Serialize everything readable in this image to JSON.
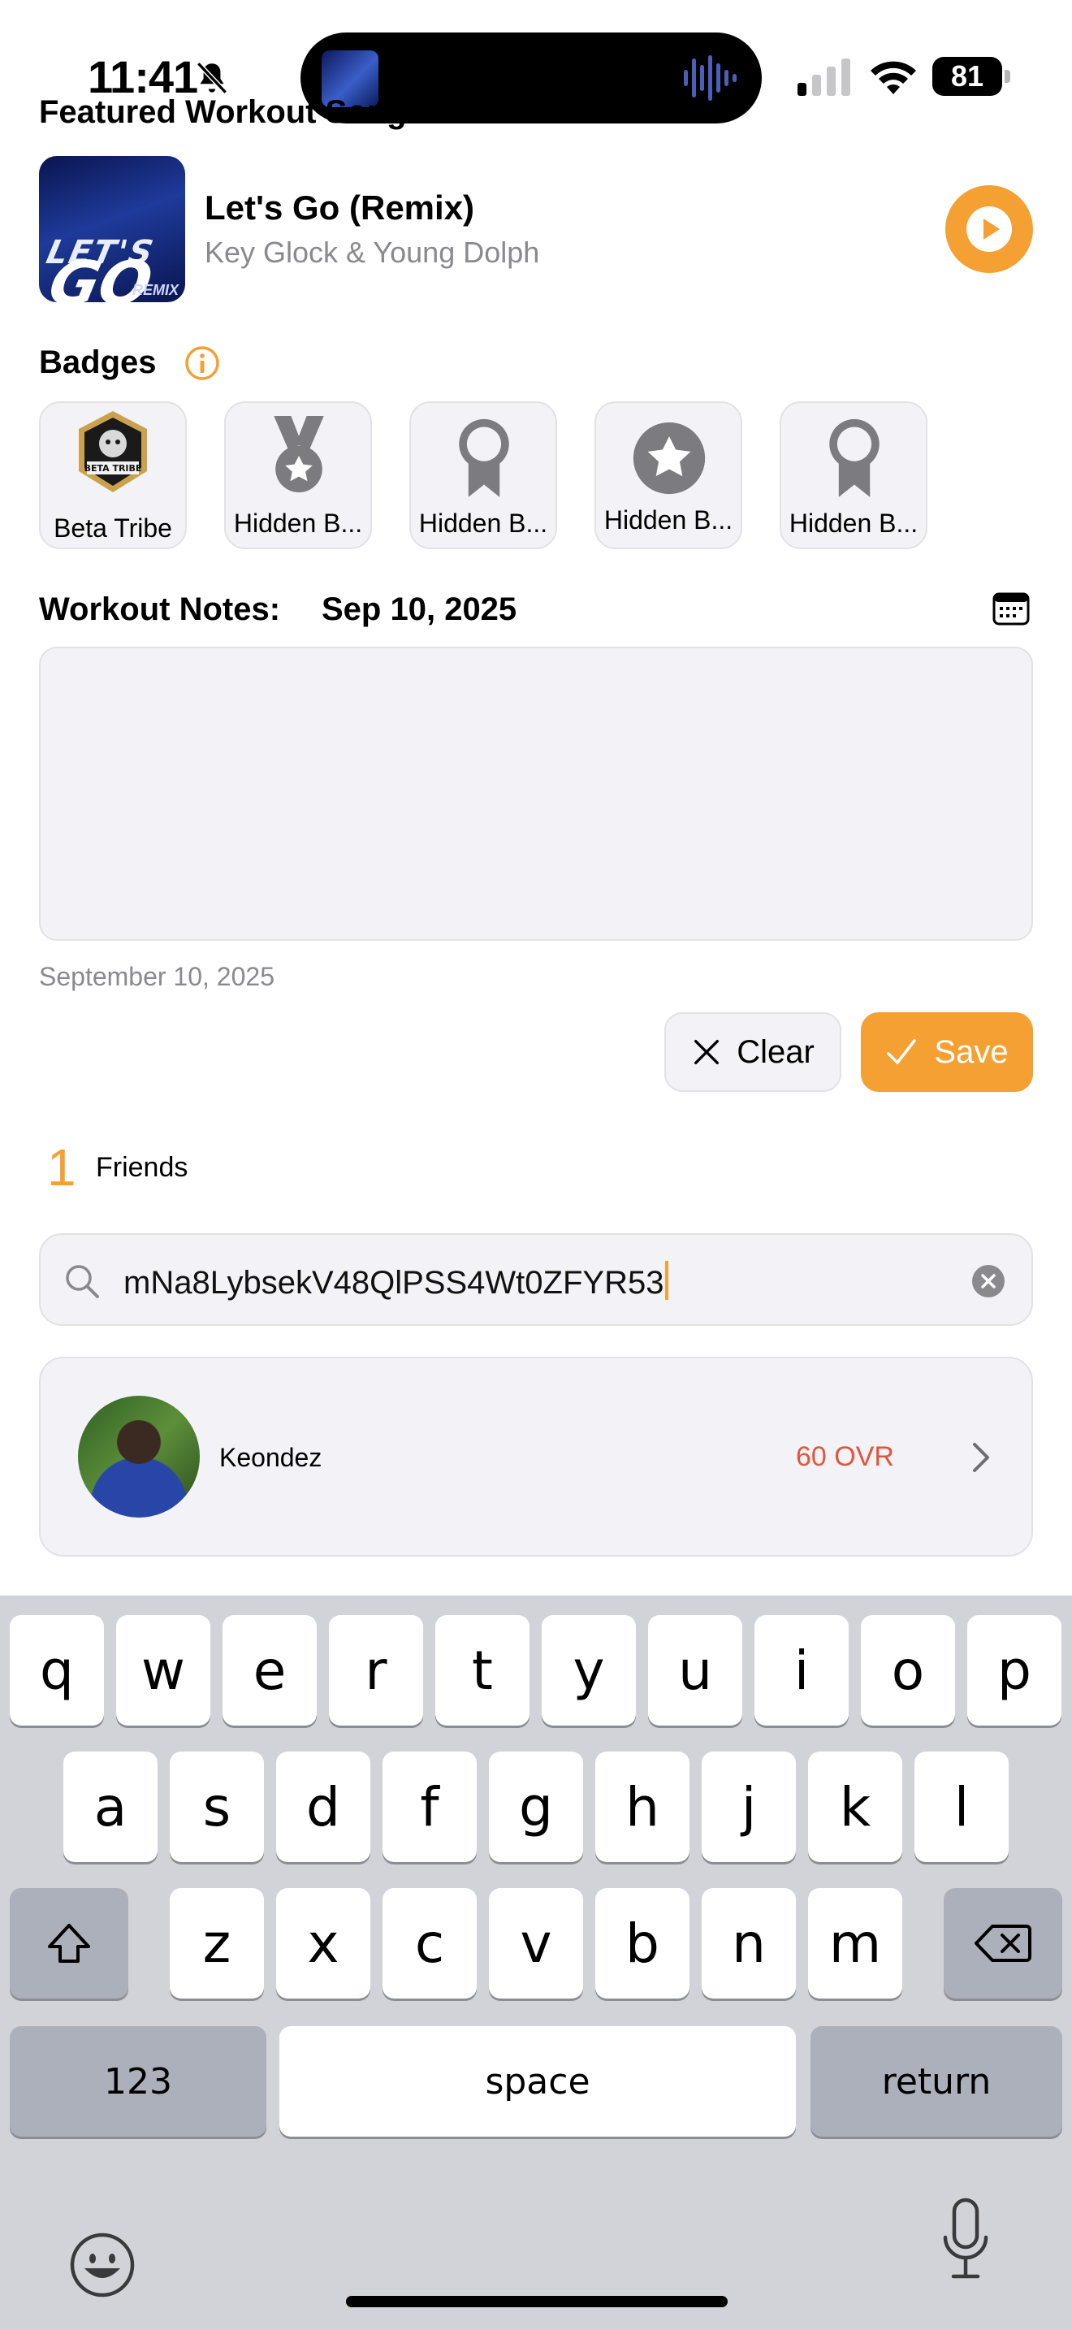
{
  "status_bar": {
    "time": "11:41",
    "battery": "81",
    "icons": [
      "bell-slash-icon",
      "signal-icon",
      "wifi-icon",
      "battery-icon"
    ]
  },
  "featured": {
    "title": "Featured Workout Song",
    "song_title": "Let's Go (Remix)",
    "artist": "Key Glock & Young Dolph",
    "album_text_top": "LET'S",
    "album_text_big": "GO",
    "album_text_small": "REMIX"
  },
  "badges": {
    "title": "Badges",
    "items": [
      {
        "label": "Beta Tribe",
        "icon": "beta-tribe-crest"
      },
      {
        "label": "Hidden B...",
        "icon": "medal-icon"
      },
      {
        "label": "Hidden B...",
        "icon": "ribbon-icon"
      },
      {
        "label": "Hidden B...",
        "icon": "star-circle-icon"
      },
      {
        "label": "Hidden B...",
        "icon": "ribbon-icon"
      }
    ],
    "beta_tribe_text": "BETA TRIBE"
  },
  "notes": {
    "label": "Workout Notes:",
    "date": "Sep 10, 2025",
    "caption": "September 10, 2025",
    "clear_label": "Clear",
    "save_label": "Save"
  },
  "friends": {
    "count": "1",
    "label": "Friends",
    "search_value": "mNa8LybsekV48QlPSS4Wt0ZFYR53",
    "items": [
      {
        "name": "Keondez",
        "ovr": "60 OVR"
      }
    ]
  },
  "keyboard": {
    "row1": [
      "q",
      "w",
      "e",
      "r",
      "t",
      "y",
      "u",
      "i",
      "o",
      "p"
    ],
    "row2": [
      "a",
      "s",
      "d",
      "f",
      "g",
      "h",
      "j",
      "k",
      "l"
    ],
    "row3": [
      "z",
      "x",
      "c",
      "v",
      "b",
      "n",
      "m"
    ],
    "numbers": "123",
    "space": "space",
    "return": "return"
  },
  "colors": {
    "accent": "#f5a033",
    "ovr": "#e0563b"
  }
}
